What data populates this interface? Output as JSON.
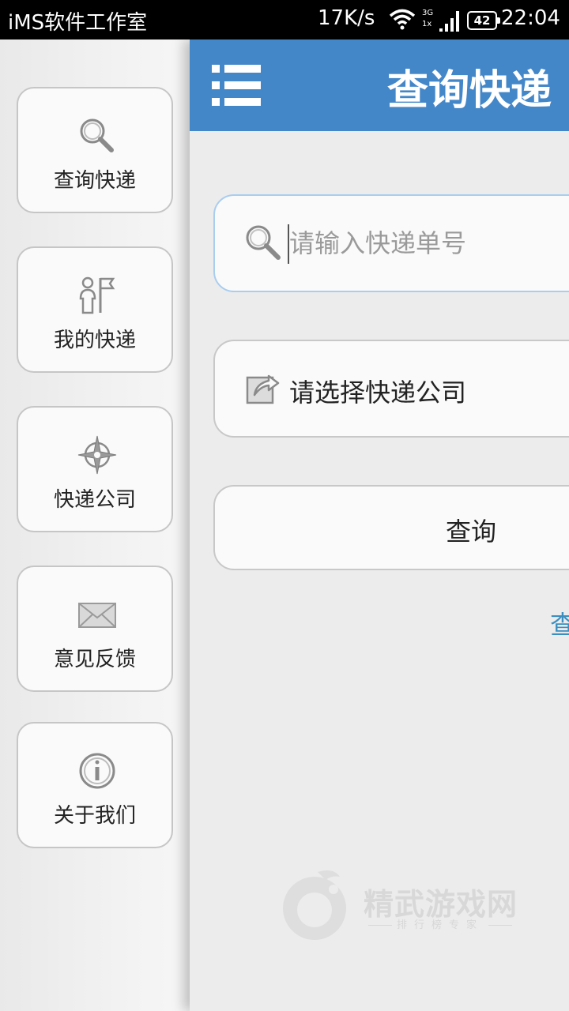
{
  "status_bar": {
    "app_name": "iMS软件工作室",
    "net_speed": "17K/s",
    "network_top": "3G",
    "network_bottom": "1x",
    "battery": "42",
    "time": "22:04"
  },
  "side_menu": {
    "items": [
      {
        "label": "查询快递",
        "icon": "search-icon"
      },
      {
        "label": "我的快递",
        "icon": "person-flag-icon"
      },
      {
        "label": "快递公司",
        "icon": "compass-icon"
      },
      {
        "label": "意见反馈",
        "icon": "envelope-icon"
      },
      {
        "label": "关于我们",
        "icon": "info-icon"
      }
    ]
  },
  "main": {
    "title": "查询快递",
    "search": {
      "placeholder": "请输入快递单号",
      "value": ""
    },
    "company_select": {
      "label": "请选择快递公司"
    },
    "query_button": {
      "label": "查询"
    },
    "history_link": "查"
  },
  "watermark": {
    "brand": "精武游戏网",
    "tagline": "排行榜专家"
  },
  "colors": {
    "app_bar": "#4487c9",
    "link": "#3a8fc0",
    "focus_border": "#a9cdef"
  }
}
